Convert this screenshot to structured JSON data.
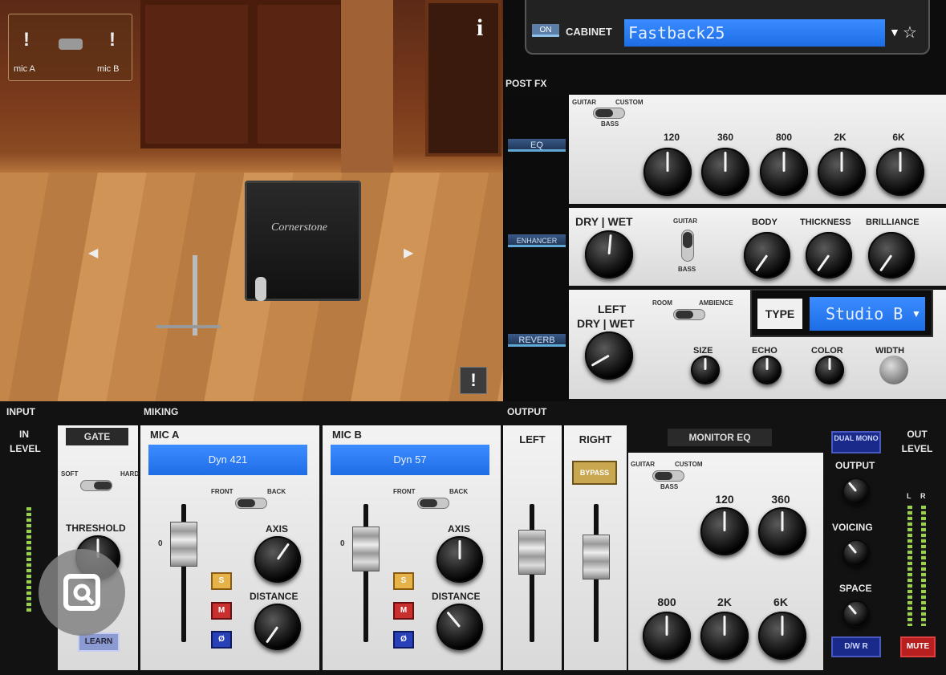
{
  "room": {
    "mic_a_label": "mic A",
    "mic_b_label": "mic B",
    "info_icon": "i",
    "cabinet_brand": "Cornerstone"
  },
  "cabinet": {
    "on_label": "ON",
    "label": "CABINET",
    "value": "Fastback25"
  },
  "post_fx": {
    "header": "POST FX",
    "eq": {
      "tab": "EQ",
      "switch_guitar": "GUITAR",
      "switch_custom": "CUSTOM",
      "switch_bass": "BASS",
      "bands": [
        "120",
        "360",
        "800",
        "2K",
        "6K"
      ]
    },
    "enhancer": {
      "tab": "ENHANCER",
      "dry_wet": "DRY | WET",
      "switch_guitar": "GUITAR",
      "switch_bass": "BASS",
      "body": "BODY",
      "thickness": "THICKNESS",
      "brilliance": "BRILLIANCE"
    },
    "reverb": {
      "tab": "REVERB",
      "left": "LEFT",
      "dry_wet": "DRY | WET",
      "switch_room": "ROOM",
      "switch_ambience": "AMBIENCE",
      "type_label": "TYPE",
      "type_value": "Studio B",
      "size": "SIZE",
      "echo": "ECHO",
      "color": "COLOR",
      "width": "WIDTH"
    }
  },
  "input": {
    "header": "INPUT",
    "in_level": "IN LEVEL",
    "gate": "GATE",
    "soft": "SOFT",
    "hard": "HARD",
    "threshold": "THRESHOLD",
    "learn": "LEARN"
  },
  "miking": {
    "header": "MIKING",
    "mic_a": {
      "title": "MIC A",
      "model": "Dyn 421",
      "front": "FRONT",
      "back": "BACK",
      "axis": "AXIS",
      "distance": "DISTANCE",
      "fader_zero": "0"
    },
    "mic_b": {
      "title": "MIC B",
      "model": "Dyn 57",
      "front": "FRONT",
      "back": "BACK",
      "axis": "AXIS",
      "distance": "DISTANCE",
      "fader_zero": "0"
    },
    "solo": "S",
    "mute": "M",
    "phase": "Ø"
  },
  "output": {
    "header": "OUTPUT",
    "left": "LEFT",
    "right": "RIGHT",
    "bypass": "BYPASS",
    "monitor_eq": "MONITOR EQ",
    "switch_guitar": "GUITAR",
    "switch_custom": "CUSTOM",
    "switch_bass": "BASS",
    "bands": [
      "120",
      "360",
      "800",
      "2K",
      "6K"
    ],
    "dual_mono": "DUAL MONO",
    "output_knob": "OUTPUT",
    "voicing": "VOICING",
    "space": "SPACE",
    "dw_r": "D/W R",
    "out_level": "OUT LEVEL",
    "meter_l": "L",
    "meter_r": "R",
    "mute": "MUTE"
  },
  "colors": {
    "accent_blue": "#2f7cf6",
    "panel": "#e6e6e6",
    "bg": "#151515"
  }
}
